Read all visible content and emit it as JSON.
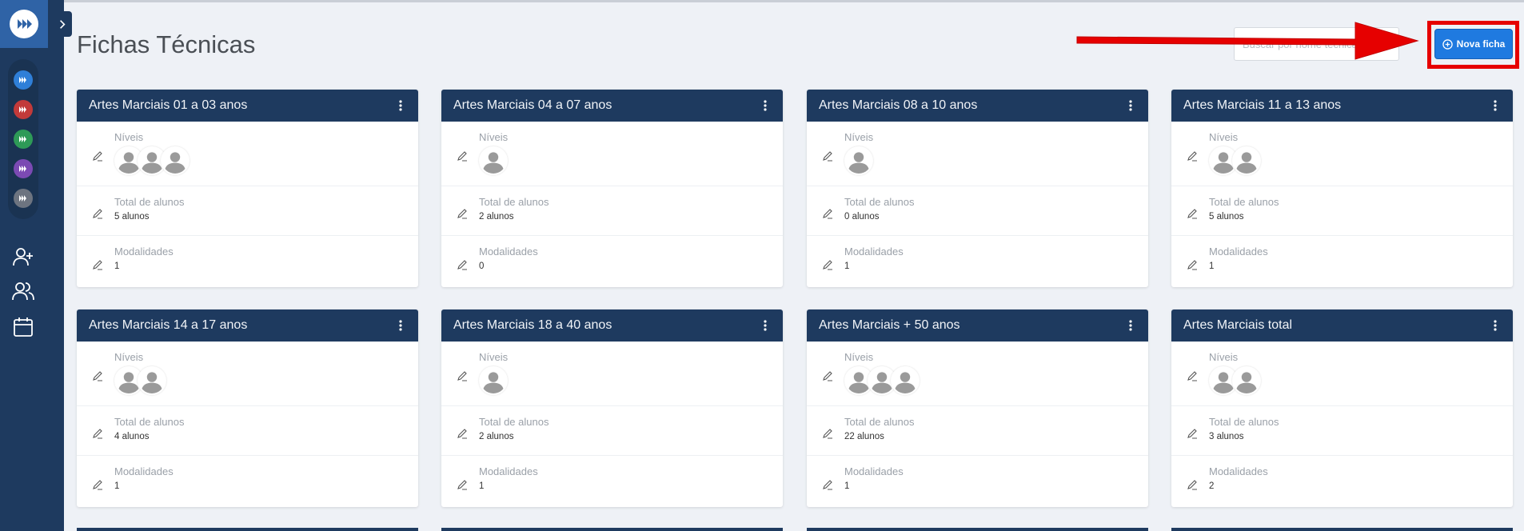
{
  "page": {
    "title": "Fichas Técnicas"
  },
  "search": {
    "placeholder": "Buscar por nome técnica"
  },
  "toolbar": {
    "new_label": "Nova ficha"
  },
  "colors": {
    "sidebar": "#1e3a5f",
    "accent": "#1f7ae0",
    "highlight": "#e60000"
  },
  "sidebar": {
    "apps": [
      {
        "icon": "app-blue-icon",
        "color": "#2f7fd8"
      },
      {
        "icon": "app-red-icon",
        "color": "#c23a3a"
      },
      {
        "icon": "app-green-icon",
        "color": "#2e9a57"
      },
      {
        "icon": "app-purple-icon",
        "color": "#7b4ab3"
      },
      {
        "icon": "app-gray-icon",
        "color": "#6d7480"
      }
    ],
    "nav": [
      "add-user-icon",
      "users-icon",
      "calendar-icon"
    ]
  },
  "labels": {
    "levels": "Níveis",
    "total": "Total de alunos",
    "modalities": "Modalidades"
  },
  "cards": [
    {
      "title": "Artes Marciais 01 a 03 anos",
      "avatars": 3,
      "total": "5 alunos",
      "modalities": "1"
    },
    {
      "title": "Artes Marciais 04 a 07 anos",
      "avatars": 1,
      "total": "2 alunos",
      "modalities": "0"
    },
    {
      "title": "Artes Marciais 08 a 10 anos",
      "avatars": 1,
      "total": "0 alunos",
      "modalities": "1"
    },
    {
      "title": "Artes Marciais 11 a 13 anos",
      "avatars": 2,
      "total": "5 alunos",
      "modalities": "1"
    },
    {
      "title": "Artes Marciais 14 a 17 anos",
      "avatars": 2,
      "total": "4 alunos",
      "modalities": "1"
    },
    {
      "title": "Artes Marciais 18 a 40 anos",
      "avatars": 1,
      "total": "2 alunos",
      "modalities": "1"
    },
    {
      "title": "Artes Marciais + 50 anos",
      "avatars": 3,
      "total": "22 alunos",
      "modalities": "1"
    },
    {
      "title": "Artes Marciais total",
      "avatars": 2,
      "total": "3 alunos",
      "modalities": "2"
    }
  ]
}
